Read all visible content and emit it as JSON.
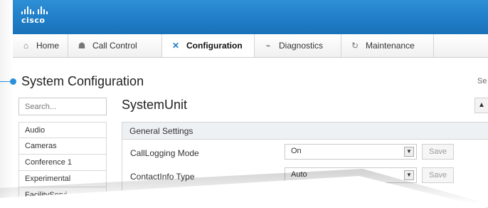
{
  "brand": {
    "logo_text": "cisco"
  },
  "nav": {
    "tabs": [
      {
        "label": "Home",
        "icon": "home-icon",
        "active": false
      },
      {
        "label": "Call Control",
        "icon": "call-control-icon",
        "active": false
      },
      {
        "label": "Configuration",
        "icon": "tools-icon",
        "active": true
      },
      {
        "label": "Diagnostics",
        "icon": "pulse-icon",
        "active": false
      },
      {
        "label": "Maintenance",
        "icon": "refresh-icon",
        "active": false
      }
    ]
  },
  "page": {
    "title": "System Configuration",
    "top_right_fragment": "Se"
  },
  "sidebar": {
    "search_placeholder": "Search...",
    "items": [
      {
        "label": "Audio"
      },
      {
        "label": "Cameras"
      },
      {
        "label": "Conference 1"
      },
      {
        "label": "Experimental"
      },
      {
        "label": "FacilityServi"
      }
    ]
  },
  "main": {
    "section_title": "SystemUnit",
    "collapse_icon": "chevron-up-icon",
    "panel_title": "General Settings",
    "rows": [
      {
        "label": "CallLogging Mode",
        "value": "On",
        "save_label": "Save"
      },
      {
        "label": "ContactInfo Type",
        "value": "Auto",
        "save_label": "Save"
      }
    ]
  },
  "colors": {
    "header": "#1f7cc6",
    "accent": "#2b8fd9"
  }
}
